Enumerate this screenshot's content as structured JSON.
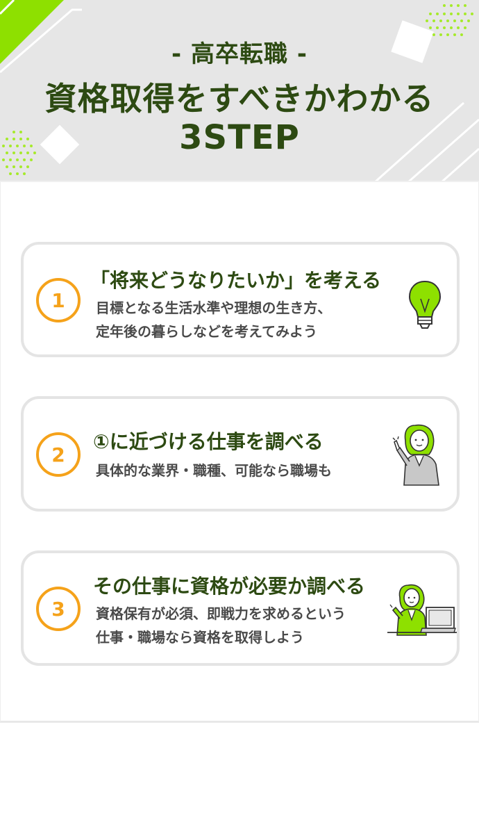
{
  "header": {
    "subtitle": "- 高卒転職 -",
    "title_line1": "資格取得をすべきかわかる",
    "title_line2": "3STEP"
  },
  "steps": [
    {
      "number": "1",
      "heading": "「将来どうなりたいか」を考える",
      "lines": [
        "目標となる生活水準や理想の生き方、",
        "定年後の暮らしなどを考えてみよう"
      ],
      "icon": "lightbulb-icon"
    },
    {
      "number": "2",
      "heading": "①に近づける仕事を調べる",
      "lines": [
        "具体的な業界・職種、可能なら職場も"
      ],
      "icon": "person-pointing-icon"
    },
    {
      "number": "3",
      "heading": "その仕事に資格が必要か調べる",
      "lines": [
        "資格保有が必須、即戦力を求めるという",
        "仕事・職場なら資格を取得しよう"
      ],
      "icon": "person-laptop-icon"
    }
  ],
  "colors": {
    "accent_green": "#8ee000",
    "heading_green": "#2d4a12",
    "number_orange": "#f5a21a",
    "header_bg": "#e6e6e6",
    "card_border": "#e4e4e4"
  }
}
